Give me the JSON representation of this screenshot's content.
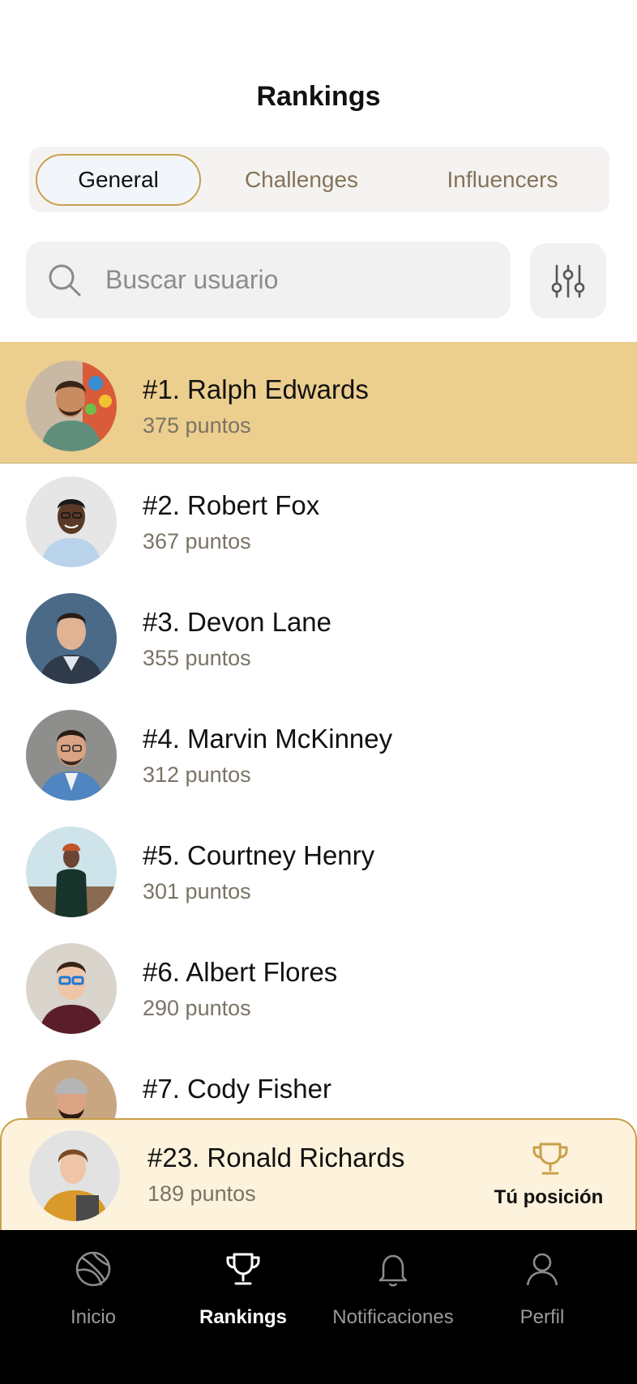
{
  "header": {
    "title": "Rankings"
  },
  "tabs": [
    {
      "label": "General",
      "active": true
    },
    {
      "label": "Challenges",
      "active": false
    },
    {
      "label": "Influencers",
      "active": false
    }
  ],
  "search": {
    "placeholder": "Buscar usuario",
    "value": ""
  },
  "ranking": [
    {
      "rank": "#1.",
      "name": "Ralph Edwards",
      "points": "375 puntos",
      "highlight": true
    },
    {
      "rank": "#2.",
      "name": "Robert Fox",
      "points": "367 puntos"
    },
    {
      "rank": "#3.",
      "name": "Devon Lane",
      "points": "355 puntos"
    },
    {
      "rank": "#4.",
      "name": "Marvin McKinney",
      "points": "312 puntos"
    },
    {
      "rank": "#5.",
      "name": "Courtney Henry",
      "points": "301 puntos"
    },
    {
      "rank": "#6.",
      "name": "Albert Flores",
      "points": "290 puntos"
    },
    {
      "rank": "#7.",
      "name": "Cody Fisher",
      "points": ""
    }
  ],
  "my_position": {
    "rank": "#23.",
    "name": "Ronald Richards",
    "points": "189 puntos",
    "label": "Tú posición",
    "icon": "trophy-icon"
  },
  "nav": [
    {
      "label": "Inicio",
      "icon": "basketball-icon",
      "active": false
    },
    {
      "label": "Rankings",
      "icon": "trophy-icon",
      "active": true
    },
    {
      "label": "Notificaciones",
      "icon": "bell-icon",
      "active": false
    },
    {
      "label": "Perfil",
      "icon": "user-icon",
      "active": false
    }
  ],
  "colors": {
    "accent": "#c9a04a",
    "highlight_row": "#ecce8e",
    "my_position_bg": "#fdf2dc",
    "nav_bg": "#000000"
  }
}
